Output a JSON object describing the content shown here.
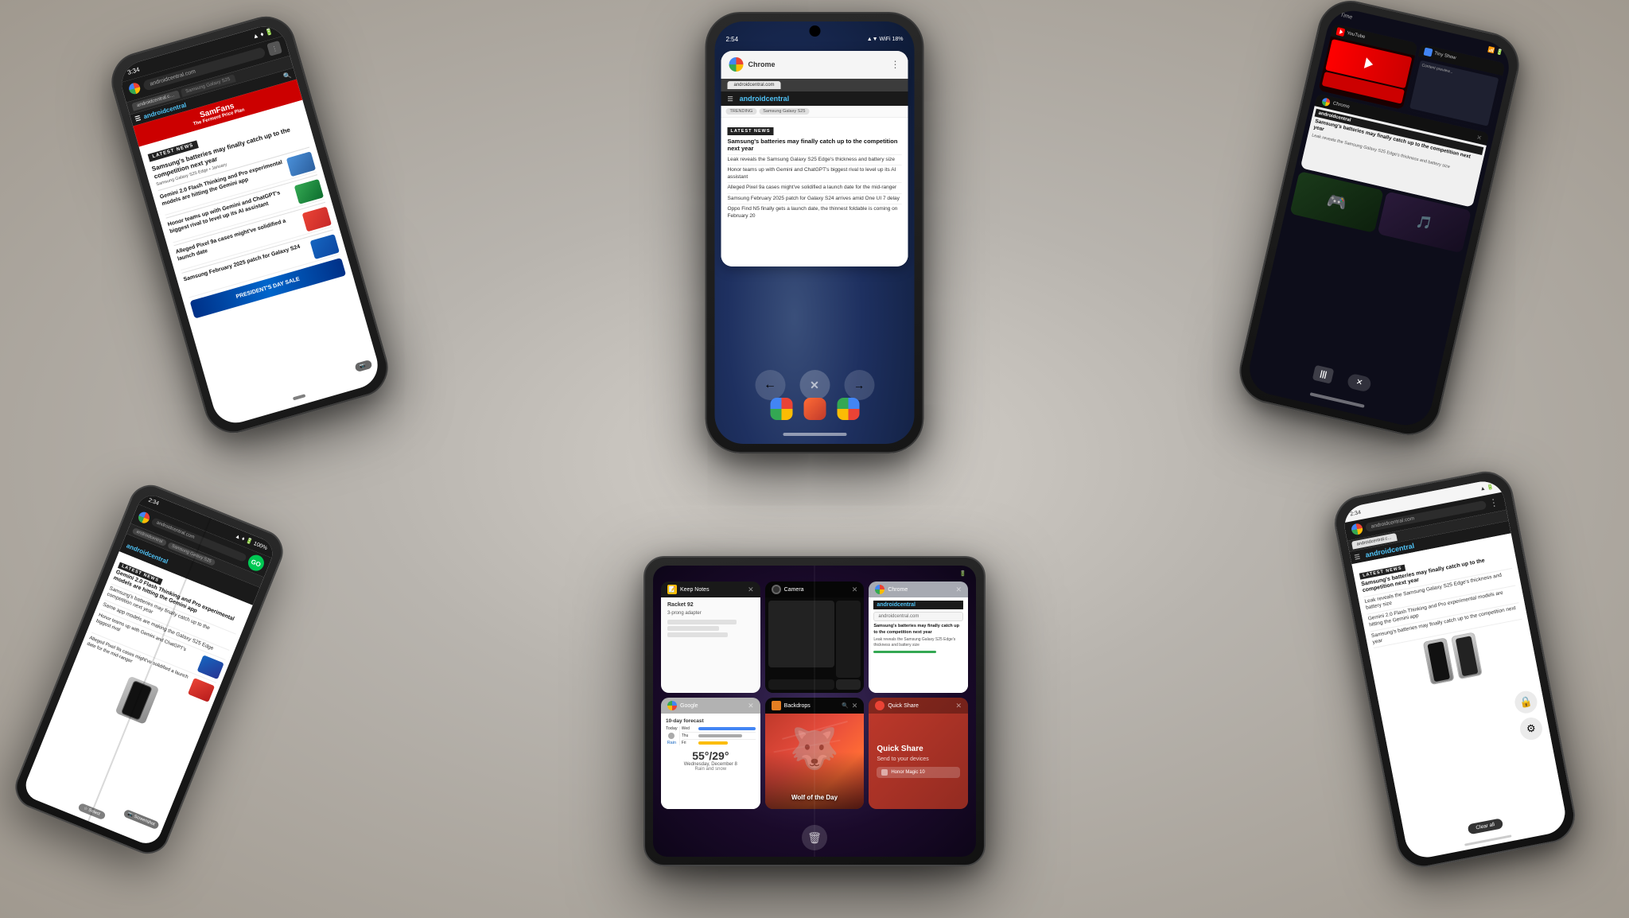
{
  "scene": {
    "background": "light gray surface"
  },
  "phones": {
    "top_center": {
      "label": "Top Center Phone",
      "status_bar": {
        "time": "2:54",
        "signal": "▲▼",
        "wifi": "WiFi",
        "battery": "18%"
      },
      "app": "Chrome Recent Apps",
      "chrome_header": "Chrome",
      "url": "androidcentral.com",
      "latest_news": "LATEST NEWS",
      "headline1": "Samsung's batteries may finally catch up to the competition next year",
      "headline2": "Leak reveals the Samsung Galaxy S25 Edge's thickness and battery size",
      "headline3": "Honor teams up with Gemini and ChatGPT's biggest rival to level up its AI assistant",
      "headline4": "Alleged Pixel 9a cases might've solidified a launch date for the mid-ranger",
      "headline5": "Samsung February 2025 patch for Galaxy S24 arrives amid One UI 7 delay",
      "headline6": "Oppo Find N5 finally gets a launch date, the thinnest foldable is coming on February 20",
      "close_button": "✕"
    },
    "top_left": {
      "label": "Top Left Phone",
      "status_bar": {
        "time": "3:34",
        "battery": "100%"
      },
      "app": "Chrome - Android Central",
      "url": "androidcentral.com",
      "tag": "Samsung Galaxy S25",
      "latest_news": "LATEST NEWS",
      "headline1": "Samsung's batteries may finally catch up to the competition next year",
      "headline2": "Gemini 2.0 Flash Thinking and Pro experimental models are hitting the Gemini app"
    },
    "top_right": {
      "label": "Top Right Phone",
      "status_bar": {
        "time": "Time"
      },
      "app": "Recent Apps / Multitasking",
      "apps": [
        "YouTube",
        "Tiny Show",
        "Chrome"
      ],
      "close_button": "✕",
      "nav_button": "|||"
    },
    "bottom_left": {
      "label": "Bottom Left Fold Phone",
      "status_bar": {
        "time": "2:34",
        "battery": "100%"
      },
      "app": "Chrome - Android Central",
      "url": "androidcentral.com",
      "latest_news": "LATEST NEWS",
      "headline1": "Gemini 2.0 Flash Thinking and Pro experimental models are hitting the Gemini app",
      "headline2": "Samsung's batteries may finally catch up to the competition next year",
      "headline3": "Same app models are making the Galaxy S25 Edge",
      "screenshot_label": "Screenshot",
      "select_label": "Select"
    },
    "tablet_center": {
      "label": "Center Tablet (Fold Open)",
      "status_bar": {
        "time": ""
      },
      "app": "Recent Apps Grid",
      "cards": [
        {
          "app_name": "Keep Notes",
          "icon_color": "#fbbc04",
          "content": "Racket 92\n3-prong adapter",
          "type": "keep"
        },
        {
          "app_name": "Camera",
          "icon_color": "#333",
          "content": "camera_grid",
          "type": "camera"
        },
        {
          "app_name": "Chrome",
          "icon_color": "chrome",
          "content": "androidcentral",
          "type": "chrome"
        },
        {
          "app_name": "Google",
          "icon_color": "#4285f4",
          "content": "google_search",
          "type": "google"
        },
        {
          "app_name": "Backdrops",
          "icon_color": "#e67e22",
          "content": "Wolf of the Day",
          "type": "backdrops"
        },
        {
          "app_name": "Quick Share",
          "icon_color": "#ea4335",
          "content": "Quick Share\nSend to your devices",
          "type": "quickshare"
        }
      ],
      "bottom_icons": [
        "trash",
        "x"
      ],
      "quick_share_title": "Quick Share",
      "quick_share_subtitle": "Send to your devices",
      "weather_temp": "55°/29°",
      "weather_desc": "Rain and snow",
      "weather_date": "Wednesday, December 8",
      "backdrops_title": "Wolf of the Day"
    },
    "bottom_right": {
      "label": "Bottom Right Phone",
      "status_bar": {
        "time": "2:34"
      },
      "app": "Chrome - Android Central",
      "url": "androidcentral.com",
      "latest_news": "LATEST NEWS",
      "headline1": "Samsung's batteries may finally catch up to the competition next year",
      "headline2": "Leak reveals the Samsung Galaxy S25 Edge's thickness and battery size",
      "headline3": "Gemini 2.0 Flash Thinking and Pro experimental models are hitting the Gemini app",
      "headline4": "Samsung's batteries may finally catch up to the competition next year",
      "lock_icon": "🔒",
      "settings_icon": "⚙",
      "clear_all": "Clear all"
    }
  }
}
